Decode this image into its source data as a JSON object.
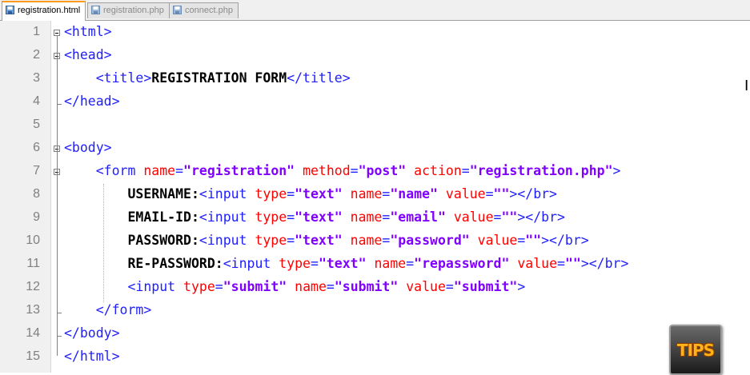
{
  "tabs": [
    {
      "label": "registration.html",
      "active": true
    },
    {
      "label": "registration.php",
      "active": false
    },
    {
      "label": "connect.php",
      "active": false
    }
  ],
  "lines": [
    {
      "num": "1",
      "tokens": [
        {
          "t": "tag",
          "v": "<html>"
        }
      ]
    },
    {
      "num": "2",
      "tokens": [
        {
          "t": "tag",
          "v": "<head>"
        }
      ]
    },
    {
      "num": "3",
      "tokens": [
        {
          "t": "sp",
          "v": "    "
        },
        {
          "t": "tag",
          "v": "<title>"
        },
        {
          "t": "txt",
          "v": "REGISTRATION FORM"
        },
        {
          "t": "tag",
          "v": "</title>"
        }
      ]
    },
    {
      "num": "4",
      "tokens": [
        {
          "t": "tag",
          "v": "</head>"
        }
      ]
    },
    {
      "num": "5",
      "tokens": []
    },
    {
      "num": "6",
      "tokens": [
        {
          "t": "tag",
          "v": "<body>"
        }
      ]
    },
    {
      "num": "7",
      "tokens": [
        {
          "t": "sp",
          "v": "    "
        },
        {
          "t": "tag",
          "v": "<form "
        },
        {
          "t": "attr",
          "v": "name"
        },
        {
          "t": "tag",
          "v": "="
        },
        {
          "t": "val",
          "v": "\"registration\""
        },
        {
          "t": "sp",
          "v": " "
        },
        {
          "t": "attr",
          "v": "method"
        },
        {
          "t": "tag",
          "v": "="
        },
        {
          "t": "val",
          "v": "\"post\""
        },
        {
          "t": "sp",
          "v": " "
        },
        {
          "t": "attr",
          "v": "action"
        },
        {
          "t": "tag",
          "v": "="
        },
        {
          "t": "val",
          "v": "\"registration.php\""
        },
        {
          "t": "tag",
          "v": ">"
        }
      ]
    },
    {
      "num": "8",
      "tokens": [
        {
          "t": "sp",
          "v": "        "
        },
        {
          "t": "txt",
          "v": "USERNAME:"
        },
        {
          "t": "tag",
          "v": "<input "
        },
        {
          "t": "attr",
          "v": "type"
        },
        {
          "t": "tag",
          "v": "="
        },
        {
          "t": "val",
          "v": "\"text\""
        },
        {
          "t": "sp",
          "v": " "
        },
        {
          "t": "attr",
          "v": "name"
        },
        {
          "t": "tag",
          "v": "="
        },
        {
          "t": "val",
          "v": "\"name\""
        },
        {
          "t": "sp",
          "v": " "
        },
        {
          "t": "attr",
          "v": "value"
        },
        {
          "t": "tag",
          "v": "="
        },
        {
          "t": "val",
          "v": "\"\""
        },
        {
          "t": "tag",
          "v": "></br>"
        }
      ]
    },
    {
      "num": "9",
      "tokens": [
        {
          "t": "sp",
          "v": "        "
        },
        {
          "t": "txt",
          "v": "EMAIL-ID:"
        },
        {
          "t": "tag",
          "v": "<input "
        },
        {
          "t": "attr",
          "v": "type"
        },
        {
          "t": "tag",
          "v": "="
        },
        {
          "t": "val",
          "v": "\"text\""
        },
        {
          "t": "sp",
          "v": " "
        },
        {
          "t": "attr",
          "v": "name"
        },
        {
          "t": "tag",
          "v": "="
        },
        {
          "t": "val",
          "v": "\"email\""
        },
        {
          "t": "sp",
          "v": " "
        },
        {
          "t": "attr",
          "v": "value"
        },
        {
          "t": "tag",
          "v": "="
        },
        {
          "t": "val",
          "v": "\"\""
        },
        {
          "t": "tag",
          "v": "></br>"
        }
      ]
    },
    {
      "num": "10",
      "tokens": [
        {
          "t": "sp",
          "v": "        "
        },
        {
          "t": "txt",
          "v": "PASSWORD:"
        },
        {
          "t": "tag",
          "v": "<input "
        },
        {
          "t": "attr",
          "v": "type"
        },
        {
          "t": "tag",
          "v": "="
        },
        {
          "t": "val",
          "v": "\"text\""
        },
        {
          "t": "sp",
          "v": " "
        },
        {
          "t": "attr",
          "v": "name"
        },
        {
          "t": "tag",
          "v": "="
        },
        {
          "t": "val",
          "v": "\"password\""
        },
        {
          "t": "sp",
          "v": " "
        },
        {
          "t": "attr",
          "v": "value"
        },
        {
          "t": "tag",
          "v": "="
        },
        {
          "t": "val",
          "v": "\"\""
        },
        {
          "t": "tag",
          "v": "></br>"
        }
      ]
    },
    {
      "num": "11",
      "tokens": [
        {
          "t": "sp",
          "v": "        "
        },
        {
          "t": "txt",
          "v": "RE-PASSWORD:"
        },
        {
          "t": "tag",
          "v": "<input "
        },
        {
          "t": "attr",
          "v": "type"
        },
        {
          "t": "tag",
          "v": "="
        },
        {
          "t": "val",
          "v": "\"text\""
        },
        {
          "t": "sp",
          "v": " "
        },
        {
          "t": "attr",
          "v": "name"
        },
        {
          "t": "tag",
          "v": "="
        },
        {
          "t": "val",
          "v": "\"repassword\""
        },
        {
          "t": "sp",
          "v": " "
        },
        {
          "t": "attr",
          "v": "value"
        },
        {
          "t": "tag",
          "v": "="
        },
        {
          "t": "val",
          "v": "\"\""
        },
        {
          "t": "tag",
          "v": "></br>"
        }
      ]
    },
    {
      "num": "12",
      "tokens": [
        {
          "t": "sp",
          "v": "        "
        },
        {
          "t": "tag",
          "v": "<input "
        },
        {
          "t": "attr",
          "v": "type"
        },
        {
          "t": "tag",
          "v": "="
        },
        {
          "t": "val",
          "v": "\"submit\""
        },
        {
          "t": "sp",
          "v": " "
        },
        {
          "t": "attr",
          "v": "name"
        },
        {
          "t": "tag",
          "v": "="
        },
        {
          "t": "val",
          "v": "\"submit\""
        },
        {
          "t": "sp",
          "v": " "
        },
        {
          "t": "attr",
          "v": "value"
        },
        {
          "t": "tag",
          "v": "="
        },
        {
          "t": "val",
          "v": "\"submit\""
        },
        {
          "t": "tag",
          "v": ">"
        }
      ]
    },
    {
      "num": "13",
      "tokens": [
        {
          "t": "sp",
          "v": "    "
        },
        {
          "t": "tag",
          "v": "</form>"
        }
      ]
    },
    {
      "num": "14",
      "tokens": [
        {
          "t": "tag",
          "v": "</body>"
        }
      ]
    },
    {
      "num": "15",
      "tokens": [
        {
          "t": "tag",
          "v": "</html>"
        }
      ]
    }
  ],
  "badge": {
    "label": "TIPS"
  },
  "colors": {
    "tag": "#1e1eff",
    "attr": "#ff0000",
    "value": "#8000ff",
    "text": "#000000",
    "line_number": "#808080",
    "active_tab_accent": "#ff9a1e"
  },
  "icons": {
    "tab": "file-save-icon",
    "cursor": "text-cursor-icon"
  }
}
